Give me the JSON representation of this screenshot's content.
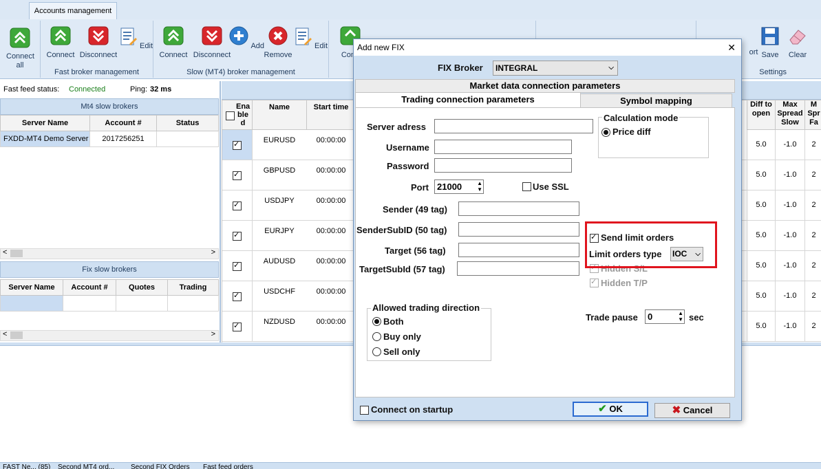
{
  "tabs": {
    "accounts": "Accounts management"
  },
  "ribbon": {
    "connect_all": "Connect all",
    "fast_connect": "Connect",
    "fast_disconnect": "Disconnect",
    "fast_edit": "Edit",
    "fast_group": "Fast broker management",
    "slow_connect": "Connect",
    "slow_disconnect": "Disconnect",
    "slow_add": "Add",
    "slow_remove": "Remove",
    "slow_edit": "Edit",
    "slow_group": "Slow (MT4)  broker management",
    "partial_connect": "Conn",
    "partial_export": "ort",
    "save": "Save",
    "clear": "Clear",
    "settings_group": "Settings"
  },
  "status": {
    "fast_feed_label": "Fast feed status:",
    "fast_feed_value": "Connected",
    "ping_label": "Ping:",
    "ping_value": "32 ms"
  },
  "mt4_panel": {
    "title": "Mt4 slow brokers",
    "headers": [
      "Server Name",
      "Account #",
      "Status"
    ],
    "rows": [
      {
        "server": "FXDD-MT4 Demo Server",
        "account": "2017256251",
        "status": ""
      }
    ]
  },
  "fix_panel": {
    "title": "Fix slow brokers",
    "headers": [
      "Server Name",
      "Account #",
      "Quotes",
      "Trading"
    ]
  },
  "symbols": {
    "headers": {
      "enabled": "Ena ble d",
      "name": "Name",
      "start": "Start time",
      "diff": "Diff to open",
      "max_slow": "Max Spread Slow",
      "max_fast": "M Spr Fa"
    },
    "rows": [
      {
        "name": "EURUSD",
        "start": "00:00:00",
        "diff": "5.0",
        "max": "-1.0",
        "fast": "2"
      },
      {
        "name": "GBPUSD",
        "start": "00:00:00",
        "diff": "5.0",
        "max": "-1.0",
        "fast": "2"
      },
      {
        "name": "USDJPY",
        "start": "00:00:00",
        "diff": "5.0",
        "max": "-1.0",
        "fast": "2"
      },
      {
        "name": "EURJPY",
        "start": "00:00:00",
        "diff": "5.0",
        "max": "-1.0",
        "fast": "2"
      },
      {
        "name": "AUDUSD",
        "start": "00:00:00",
        "diff": "5.0",
        "max": "-1.0",
        "fast": "2"
      },
      {
        "name": "USDCHF",
        "start": "00:00:00",
        "diff": "5.0",
        "max": "-1.0",
        "fast": "2"
      },
      {
        "name": "NZDUSD",
        "start": "00:00:00",
        "diff": "5.0",
        "max": "-1.0",
        "fast": "2"
      }
    ]
  },
  "bottom_tabs": [
    "FAST Ne... (85)",
    "Second MT4 ord...",
    "Second FIX Orders",
    "Fast feed orders"
  ],
  "dialog": {
    "title": "Add new FIX",
    "close": "✕",
    "broker_label": "FIX Broker",
    "broker_value": "INTEGRAL",
    "tab_market": "Market data connection parameters",
    "tab_trading": "Trading connection parameters",
    "tab_symbol": "Symbol mapping",
    "server_label": "Server adress",
    "server_value": "",
    "username_label": "Username",
    "password_label": "Password",
    "port_label": "Port",
    "port_value": "21000",
    "ssl_label": "Use SSL",
    "sender_label": "Sender (49 tag)",
    "sendersub_label": "SenderSubID (50 tag)",
    "target_label": "Target (56 tag)",
    "targetsub_label": "TargetSubId (57 tag)",
    "calc_title": "Calculation mode",
    "calc_price_diff": "Price diff",
    "send_limit_label": "Send limit orders",
    "limit_type_label": "Limit orders type",
    "limit_type_value": "IOC",
    "hidden_sl": "Hidden S/L",
    "hidden_tp": "Hidden T/P",
    "direction_title": "Allowed trading direction",
    "dir_both": "Both",
    "dir_buy": "Buy only",
    "dir_sell": "Sell only",
    "pause_label": "Trade pause",
    "pause_value": "0",
    "pause_unit": "sec",
    "startup_label": "Connect on startup",
    "ok": "OK",
    "cancel": "Cancel"
  },
  "colors": {
    "highlight": "#e0141e",
    "connected": "#1a7f1a",
    "ribbon": "#dfeaf6"
  }
}
